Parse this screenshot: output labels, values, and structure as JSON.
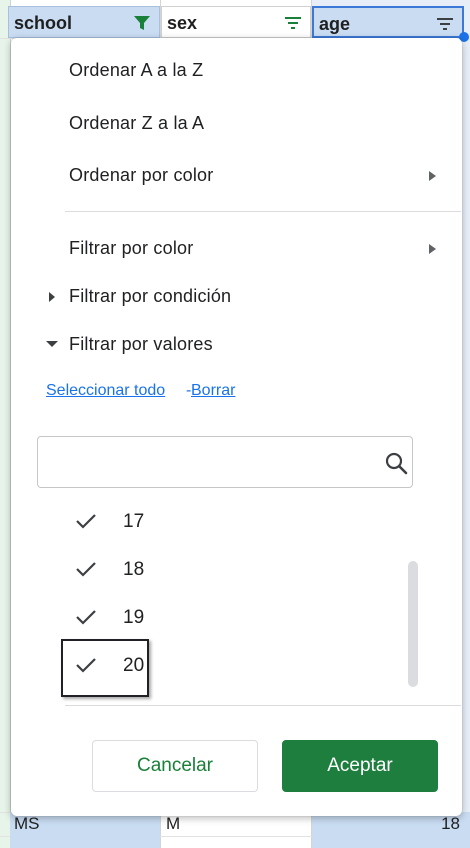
{
  "headers": {
    "col_a": "school",
    "col_b": "sex",
    "col_c": "age"
  },
  "bottom_row": {
    "col_a": "MS",
    "col_b": "M",
    "col_c": "18"
  },
  "menu": {
    "sort_az": "Ordenar A a la Z",
    "sort_za": "Ordenar Z a la A",
    "sort_color": "Ordenar por color",
    "filter_color": "Filtrar por color",
    "filter_condition": "Filtrar por condición",
    "filter_values": "Filtrar por valores"
  },
  "links": {
    "select_all": "Seleccionar todo",
    "separator": "-",
    "clear": "Borrar"
  },
  "search": {
    "value": "",
    "placeholder": ""
  },
  "values": [
    {
      "label": "17",
      "checked": true
    },
    {
      "label": "18",
      "checked": true
    },
    {
      "label": "19",
      "checked": true
    },
    {
      "label": "20",
      "checked": true
    }
  ],
  "buttons": {
    "cancel": "Cancelar",
    "ok": "Aceptar"
  },
  "colors": {
    "accent_green": "#1e7e3e",
    "link_blue": "#1a73e8",
    "header_blue": "#c9dcf2"
  },
  "icons": {
    "filter_active": "filter-active-icon",
    "filter": "filter-icon",
    "search": "search-icon",
    "check": "check-icon"
  }
}
